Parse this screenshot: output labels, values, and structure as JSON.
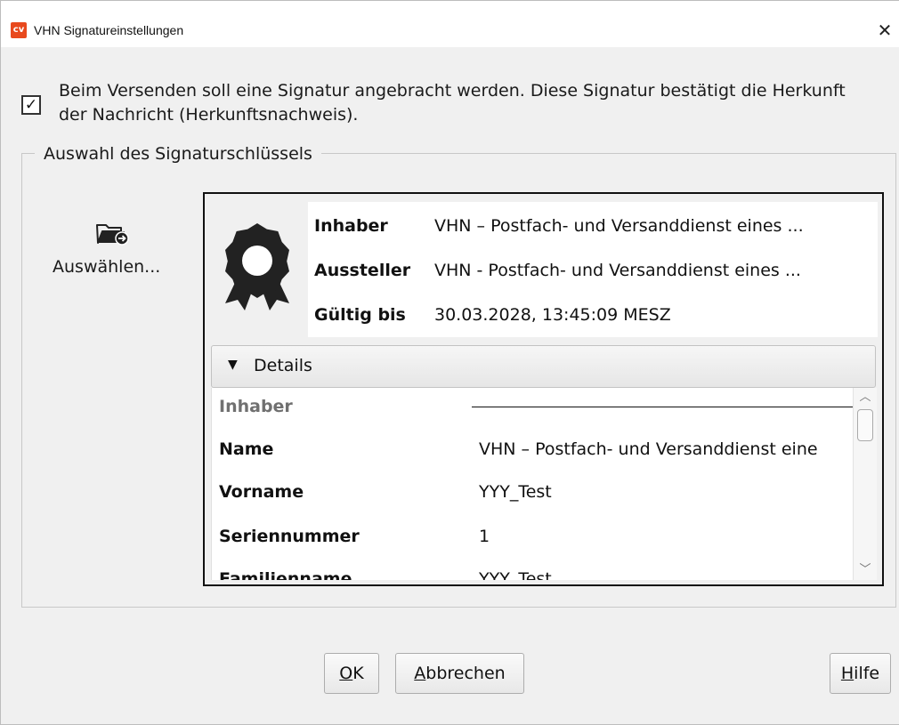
{
  "window": {
    "title": "VHN Signatureinstellungen",
    "app_icon_text": "cv",
    "close_glyph": "✕"
  },
  "signature_option": {
    "checked": true,
    "check_glyph": "✓",
    "label": "Beim Versenden soll eine Signatur angebracht werden. Diese Signatur bestätigt die Herkunft der Nachricht (Herkunftsnachweis)."
  },
  "key_selection": {
    "legend": "Auswahl des Signaturschlüssels",
    "select_icon": "folder-open-arrow-icon",
    "select_label": "Auswählen...",
    "certificate": {
      "icon": "award-icon",
      "rows": [
        {
          "label": "Inhaber",
          "value": "VHN – Postfach- und Versanddienst eines ..."
        },
        {
          "label": "Aussteller",
          "value": "VHN - Postfach- und Versanddienst eines ..."
        },
        {
          "label": "Gültig bis",
          "value": "30.03.2028, 13:45:09 MESZ"
        }
      ]
    },
    "details": {
      "toggle_glyph": "▼",
      "label": "Details",
      "section_header": "Inhaber",
      "rows": [
        {
          "key": "Name",
          "value": "VHN – Postfach- und Versanddienst eine"
        },
        {
          "key": "Vorname",
          "value": "YYY_Test"
        },
        {
          "key": "Seriennummer",
          "value": "1"
        },
        {
          "key": "Familienname",
          "value": "YYY_Test"
        }
      ]
    }
  },
  "buttons": {
    "ok": {
      "mnemonic": "O",
      "rest": "K"
    },
    "cancel": {
      "mnemonic": "A",
      "rest": "bbrechen"
    },
    "help": {
      "mnemonic": "H",
      "rest": "ilfe"
    }
  },
  "colors": {
    "app_icon": "#e8491d",
    "background": "#f0f0f0"
  }
}
